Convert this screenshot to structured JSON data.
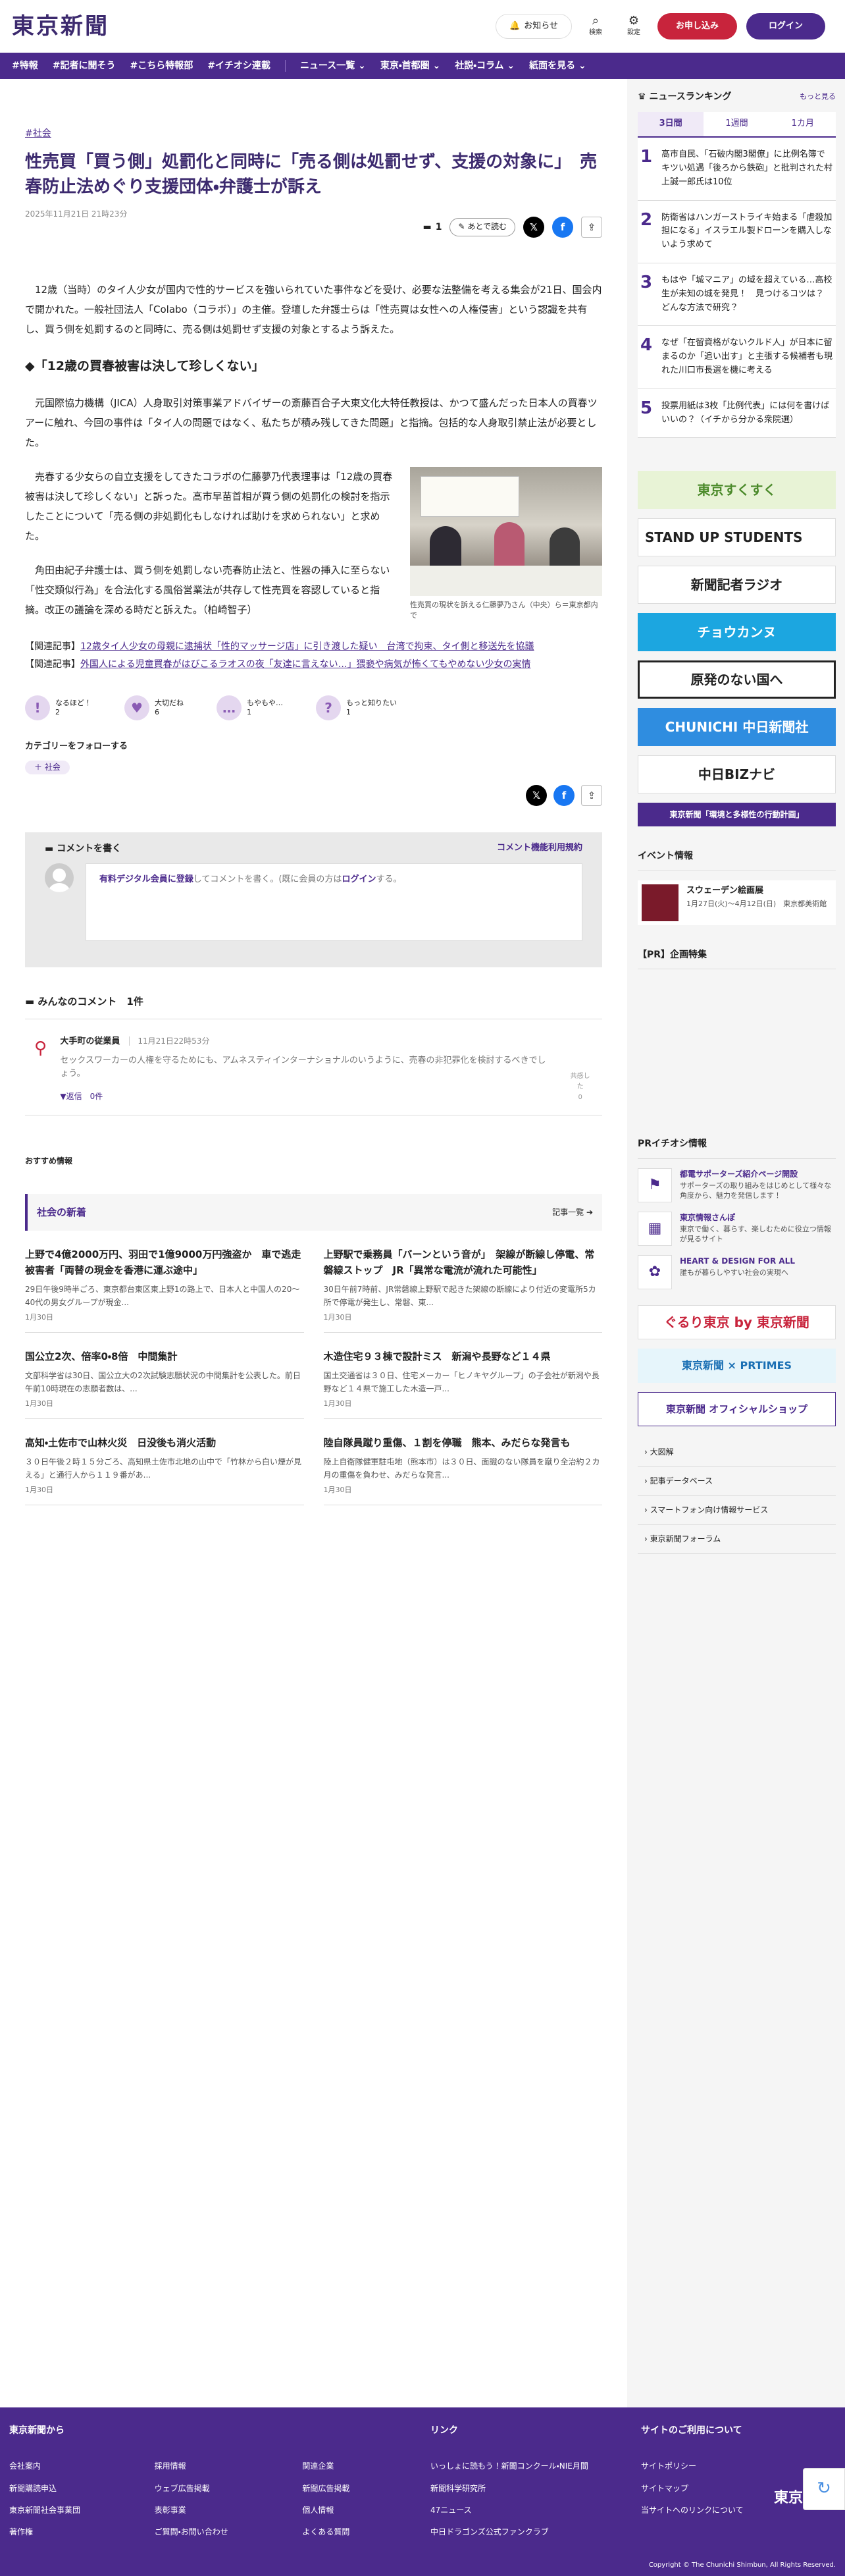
{
  "header": {
    "logo": "東京新聞",
    "notice": "お知らせ",
    "search": "検索",
    "settings": "設定",
    "apply": "お申し込み",
    "login": "ログイン"
  },
  "gnav": [
    "#特報",
    "#記者に聞そう",
    "#こちら特報部",
    "#イチオシ連載",
    "ニュース一覧 ⌄",
    "東京・首都圏 ⌄",
    "社説・コラム ⌄",
    "紙面を見る ⌄"
  ],
  "article": {
    "category": "#社会",
    "title": "性売買「買う側」処罰化と同時に「売る側は処罰せず、支援の対象に」　売春防止法めぐり支援団体・弁護士が訴え",
    "date": "2025年11月21日 21時23分",
    "comment_count": "1",
    "read_later": "あとで読む",
    "p1": "12歳（当時）のタイ人少女が国内で性的サービスを強いられていた事件などを受け、必要な法整備を考える集会が21日、国会内で開かれた。一般社団法人「Colabo（コラボ）」の主催。登壇した弁護士らは「性売買は女性への人権侵害」という認識を共有し、買う側を処罰するのと同時に、売る側は処罰せず支援の対象とするよう訴えた。",
    "h2": "◆「12歳の買春被害は決して珍しくない」",
    "p2": "元国際協力機構（JICA）人身取引対策事業アドバイザーの斎藤百合子大東文化大特任教授は、かつて盛んだった日本人の買春ツアーに触れ、今回の事件は「タイ人の問題ではなく、私たちが積み残してきた問題」と指摘。包括的な人身取引禁止法が必要とした。",
    "p3": "売春する少女らの自立支援をしてきたコラボの仁藤夢乃代表理事は「12歳の買春被害は決して珍しくない」と訴った。高市早苗首相が買う側の処罰化の検討を指示したことについて「売る側の非処罰化もしなければ助けを求められない」と求めた。",
    "p4": "角田由紀子弁護士は、買う側を処罰しない売春防止法と、性器の挿入に至らない「性交類似行為」を合法化する風俗営業法が共存して性売買を容認していると指摘。改正の議論を深める時だと訴えた。（柏崎智子）",
    "caption": "性売買の現状を訴える仁藤夢乃さん（中央）ら＝東京都内で",
    "rel_label1": "【関連記事】",
    "rel_link1": "12歳タイ人少女の母親に逮捕状「性的マッサージ店」に引き渡した疑い　台湾で拘束、タイ側と移送先を協議",
    "rel_label2": "【関連記事】",
    "rel_link2": "外国人による児童買春がはびこるラオスの夜「友達に言えない…」猥褻や病気が怖くてもやめない少女の実情"
  },
  "reactions": [
    {
      "icon": "!",
      "label": "なるほど！",
      "count": "2"
    },
    {
      "icon": "♥",
      "label": "大切だね",
      "count": "6"
    },
    {
      "icon": "…",
      "label": "もやもや…",
      "count": "1"
    },
    {
      "icon": "?",
      "label": "もっと知りたい",
      "count": "1"
    }
  ],
  "follow": {
    "label": "カテゴリーをフォローする",
    "tag": "＋ 社会"
  },
  "comment_box": {
    "title": "コメントを書く",
    "rule": "コメント機能利用規約",
    "prompt_link": "有料デジタル会員に登録",
    "prompt_mid": "してコメントを書く。(既に会員の方は",
    "prompt_login": "ログイン",
    "prompt_end": "する。"
  },
  "comments": {
    "title": "みんなのコメント　1件",
    "items": [
      {
        "name": "大手町の従業員",
        "time": "11月21日22時53分",
        "text": "セックスワーカーの人権を守るためにも、アムネスティインターナショナルのいうように、売春の非犯罪化を検討するべきでしょう。",
        "reply": "▼返信　0件",
        "respect": "共感した",
        "respect_count": "0"
      }
    ]
  },
  "recommend": "おすすめ情報",
  "news": {
    "title": "社会の新着",
    "more": "記事一覧",
    "items": [
      {
        "h": "上野で4億2000万円、羽田で1億9000万円強盗か　車で逃走　被害者「両替の現金を香港に運ぶ途中」",
        "p": "29日午後9時半ごろ、東京都台東区東上野1の路上で、日本人と中国人の20～40代の男女グループが現金...",
        "d": "1月30日"
      },
      {
        "h": "上野駅で乗務員「バーンという音が」　架線が断線し停電、常磐線ストップ　JR「異常な電流が流れた可能性」",
        "p": "30日午前7時前、JR常磐線上野駅で起きた架線の断線により付近の変電所5カ所で停電が発生し、常磐、東...",
        "d": "1月30日"
      },
      {
        "h": "国公立2次、倍率0・8倍　中間集計",
        "p": "文部科学省は30日、国公立大の2次試験志願状況の中間集計を公表した。前日午前10時現在の志願者数は、...",
        "d": "1月30日"
      },
      {
        "h": "木造住宅９３棟で設計ミス　新潟や長野など１４県",
        "p": "国土交通省は３０日、住宅メーカー「ヒノキヤグループ」の子会社が新潟や長野など１４県で施工した木造一戸...",
        "d": "1月30日"
      },
      {
        "h": "高知・土佐市で山林火災　日没後も消火活動",
        "p": "３０日午後２時１５分ごろ、高知県土佐市北地の山中で「竹林から白い煙が見える」と通行人から１１９番があ...",
        "d": "1月30日"
      },
      {
        "h": "陸自隊員蹴り重傷、１割を停職　熊本、みだらな発言も",
        "p": "陸上自衛隊健軍駐屯地（熊本市）は３０日、面識のない隊員を蹴り全治約２カ月の重傷を負わせ、みだらな発言...",
        "d": "1月30日"
      }
    ]
  },
  "ranking": {
    "title": "ニュースランキング",
    "more": "もっと見る",
    "tabs": [
      "3日間",
      "1週間",
      "1カ月"
    ],
    "items": [
      {
        "n": "1",
        "t": "高市自民、「石破内閣3閣僚」に比例名簿でキツい処遇「後ろから鉄砲」と批判された村上誠一郎氏は10位"
      },
      {
        "n": "2",
        "t": "防衛省はハンガーストライキ始まる「虐殺加担になる」イスラエル製ドローンを購入しないよう求めて"
      },
      {
        "n": "3",
        "t": "もはや「城マニア」の域を超えている…高校生が未知の城を発見！　見つけるコツは？　どんな方法で研究？"
      },
      {
        "n": "4",
        "t": "なぜ「在留資格がないクルド人」が日本に留まるのか「追い出す」と主張する候補者も現れた川口市長選を機に考える"
      },
      {
        "n": "5",
        "t": "投票用紙は3枚「比例代表」には何を書けばいいの？（イチから分かる衆院選）"
      }
    ]
  },
  "banners": [
    "東京すくすく",
    "STAND UP STUDENTS",
    "新聞記者ラジオ",
    "チョウカンヌ",
    "原発のない国へ",
    "CHUNICHI 中日新聞社",
    "中日BIZナビ",
    "東京新聞「環境と多様性の行動計画」"
  ],
  "events": {
    "title": "イベント情報",
    "items": [
      {
        "t": "スウェーデン絵画展",
        "s": "1月27日(火)～4月12日(日)　東京都美術館"
      }
    ]
  },
  "pr_title": "【PR】企画特集",
  "pr_info": {
    "title": "PRイチオシ情報",
    "items": [
      {
        "t": "都電サポーターズ紹介ページ開設",
        "s": "サポーターズの取り組みをはじめとして様々な角度から、魅力を発信します！"
      },
      {
        "t": "東京情報さんぽ",
        "s": "東京で働く、暮らす、楽しむために役立つ情報が見るサイト"
      },
      {
        "t": "HEART & DESIGN FOR ALL",
        "s": "誰もが暮らしやすい社会の実現へ"
      }
    ]
  },
  "banners2": [
    "ぐるり東京 by 東京新聞",
    "東京新聞 × PRTIMES",
    "東京新聞 オフィシャルショップ"
  ],
  "side_links": [
    "大図解",
    "記事データベース",
    "スマートフォン向け情報サービス",
    "東京新聞フォーラム"
  ],
  "footer": {
    "col1": "東京新聞から",
    "col2": "リンク",
    "col3": "サイトのご利用について",
    "links1": [
      "会社案内",
      "採用情報",
      "関連企業",
      "新聞購読申込",
      "ウェブ広告掲載",
      "新聞広告掲載",
      "東京新聞社会事業団",
      "表彰事業",
      "個人情報",
      "著作権",
      "ご質問・お問い合わせ",
      "よくある質問"
    ],
    "links2": [
      "いっしょに読もう！新聞コンクール・NIE月間",
      "新聞科学研究所",
      "47ニュース",
      "中日ドラゴンズ公式ファンクラブ"
    ],
    "links3": [
      "サイトポリシー",
      "サイトマップ",
      "当サイトへのリンクについて"
    ],
    "logo": "東京新聞",
    "copyright": "Copyright © The Chunichi Shimbun, All Rights Reserved."
  }
}
